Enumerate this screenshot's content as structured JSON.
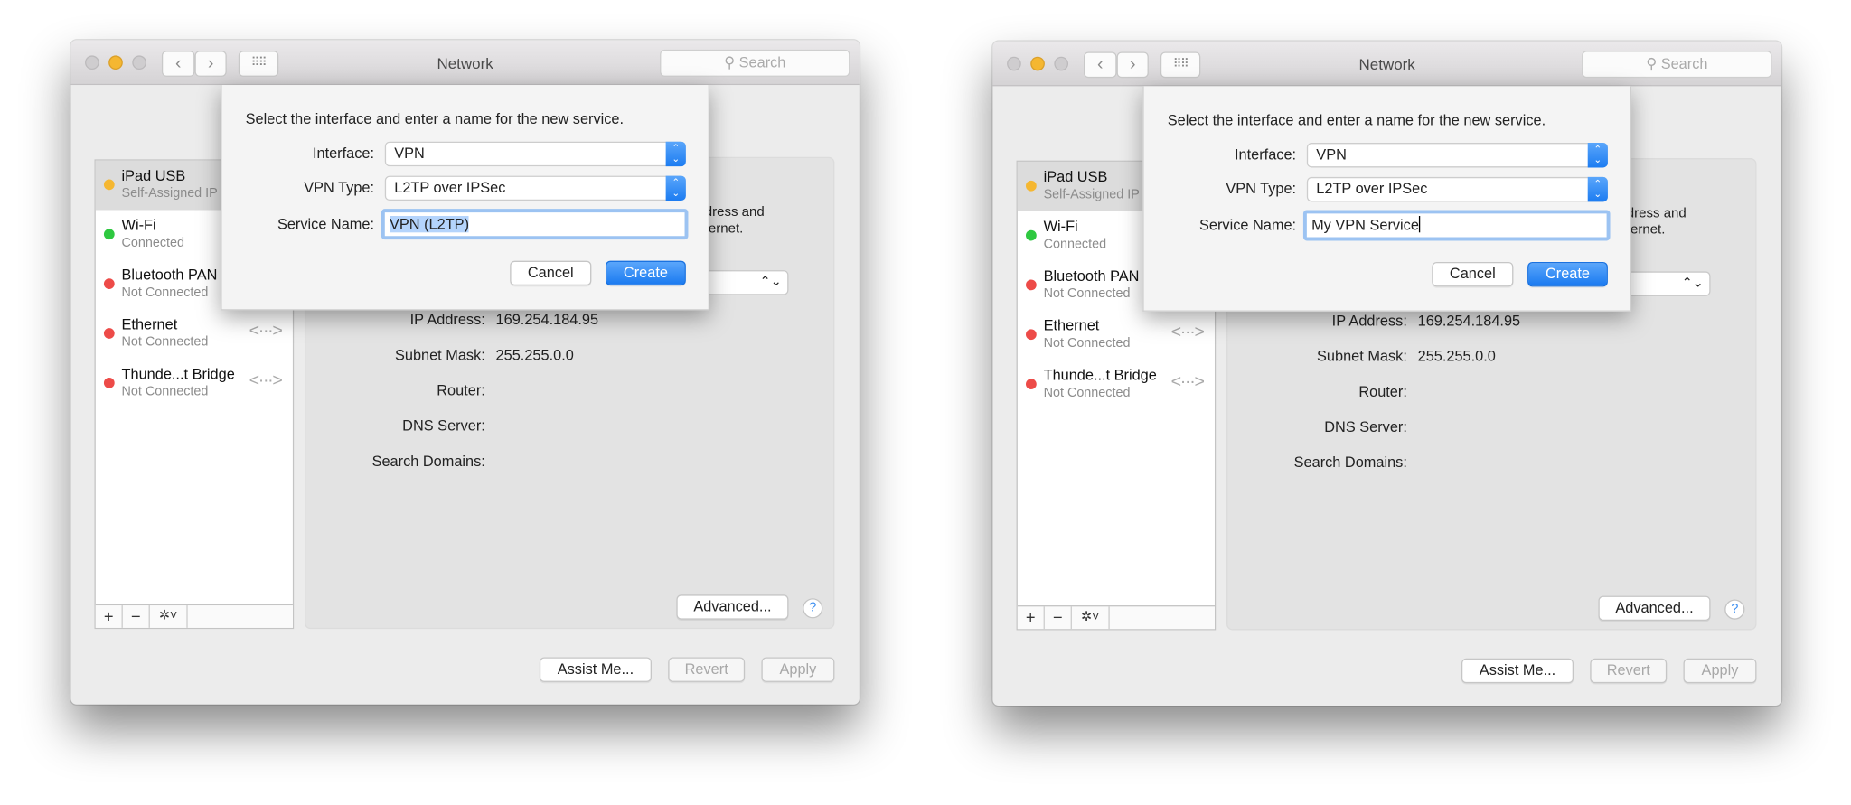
{
  "colors": {
    "accent": "#1c7cf1",
    "status_yellow": "#f5b731",
    "status_green": "#2ec840",
    "status_red": "#ed4b48"
  },
  "windows": [
    {
      "title": "Network",
      "search_placeholder": "Search",
      "toolbar": {
        "back_icon": "chevron-left",
        "forward_icon": "chevron-right",
        "grid_icon": "grid-icon"
      },
      "services": [
        {
          "name": "iPad USB",
          "status": "Self-Assigned IP",
          "state": "yellow",
          "selected": true
        },
        {
          "name": "Wi-Fi",
          "status": "Connected",
          "state": "green"
        },
        {
          "name": "Bluetooth PAN",
          "status": "Not Connected",
          "state": "red"
        },
        {
          "name": "Ethernet",
          "status": "Not Connected",
          "state": "red",
          "icon": "<···>"
        },
        {
          "name": "Thunde...t Bridge",
          "status": "Not Connected",
          "state": "red",
          "icon": "<···>"
        }
      ],
      "sidebar_controls": {
        "add": "+",
        "remove": "−",
        "gear": "✲˅"
      },
      "detail_fragment": [
        "dress and",
        "ternet."
      ],
      "details": [
        {
          "label": "IP Address:",
          "value": "169.254.184.95"
        },
        {
          "label": "Subnet Mask:",
          "value": "255.255.0.0"
        },
        {
          "label": "Router:",
          "value": ""
        },
        {
          "label": "DNS Server:",
          "value": ""
        },
        {
          "label": "Search Domains:",
          "value": ""
        }
      ],
      "advanced": "Advanced...",
      "help": "?",
      "assist": "Assist Me...",
      "revert": "Revert",
      "apply": "Apply",
      "sheet": {
        "prompt": "Select the interface and enter a name for the new service.",
        "interface_label": "Interface:",
        "interface_value": "VPN",
        "vpn_type_label": "VPN Type:",
        "vpn_type_value": "L2TP over IPSec",
        "service_name_label": "Service Name:",
        "service_name_value": "VPN (L2TP)",
        "service_name_selected": true,
        "cancel": "Cancel",
        "create": "Create"
      }
    },
    {
      "title": "Network",
      "search_placeholder": "Search",
      "toolbar": {
        "back_icon": "chevron-left",
        "forward_icon": "chevron-right",
        "grid_icon": "grid-icon"
      },
      "services": [
        {
          "name": "iPad USB",
          "status": "Self-Assigned IP",
          "state": "yellow",
          "selected": true
        },
        {
          "name": "Wi-Fi",
          "status": "Connected",
          "state": "green"
        },
        {
          "name": "Bluetooth PAN",
          "status": "Not Connected",
          "state": "red"
        },
        {
          "name": "Ethernet",
          "status": "Not Connected",
          "state": "red",
          "icon": "<···>"
        },
        {
          "name": "Thunde...t Bridge",
          "status": "Not Connected",
          "state": "red",
          "icon": "<···>"
        }
      ],
      "sidebar_controls": {
        "add": "+",
        "remove": "−",
        "gear": "✲˅"
      },
      "detail_fragment": [
        "dress and",
        "ternet."
      ],
      "details": [
        {
          "label": "IP Address:",
          "value": "169.254.184.95"
        },
        {
          "label": "Subnet Mask:",
          "value": "255.255.0.0"
        },
        {
          "label": "Router:",
          "value": ""
        },
        {
          "label": "DNS Server:",
          "value": ""
        },
        {
          "label": "Search Domains:",
          "value": ""
        }
      ],
      "advanced": "Advanced...",
      "help": "?",
      "assist": "Assist Me...",
      "revert": "Revert",
      "apply": "Apply",
      "sheet": {
        "prompt": "Select the interface and enter a name for the new service.",
        "interface_label": "Interface:",
        "interface_value": "VPN",
        "vpn_type_label": "VPN Type:",
        "vpn_type_value": "L2TP over IPSec",
        "service_name_label": "Service Name:",
        "service_name_value": "My VPN Service",
        "service_name_selected": false,
        "cancel": "Cancel",
        "create": "Create"
      }
    }
  ]
}
